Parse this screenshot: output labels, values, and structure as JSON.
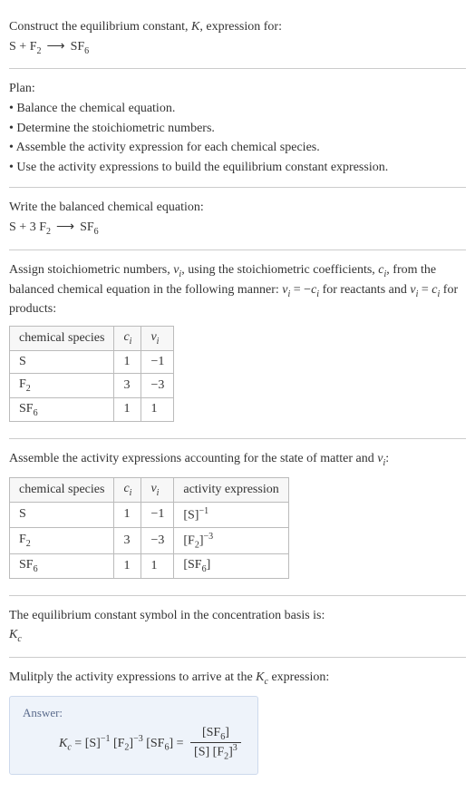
{
  "intro": {
    "line1": "Construct the equilibrium constant, ",
    "K": "K",
    "line1_cont": ", expression for:",
    "reactant1": "S",
    "plus": " + ",
    "reactant2_main": "F",
    "reactant2_sub": "2",
    "arrow": "⟶",
    "product_main": "SF",
    "product_sub": "6"
  },
  "plan": {
    "heading": "Plan:",
    "b1": "• Balance the chemical equation.",
    "b2": "• Determine the stoichiometric numbers.",
    "b3": "• Assemble the activity expression for each chemical species.",
    "b4": "• Use the activity expressions to build the equilibrium constant expression."
  },
  "balanced": {
    "title": "Write the balanced chemical equation:",
    "r1": "S",
    "plus": " + ",
    "coef2": "3 ",
    "r2_main": "F",
    "r2_sub": "2",
    "arrow": "⟶",
    "p_main": "SF",
    "p_sub": "6"
  },
  "stoich": {
    "text1": "Assign stoichiometric numbers, ",
    "nu": "ν",
    "nu_i": "i",
    "text2": ", using the stoichiometric coefficients, ",
    "c": "c",
    "c_i": "i",
    "text3": ", from the balanced chemical equation in the following manner: ",
    "eq1_lhs_nu": "ν",
    "eq1_lhs_i": "i",
    "eq1_eq": " = −",
    "eq1_rhs_c": "c",
    "eq1_rhs_i": "i",
    "text4": " for reactants and ",
    "eq2_lhs_nu": "ν",
    "eq2_lhs_i": "i",
    "eq2_eq": " = ",
    "eq2_rhs_c": "c",
    "eq2_rhs_i": "i",
    "text5": " for products:",
    "th_species": "chemical species",
    "th_c": "c",
    "th_c_i": "i",
    "th_nu": "ν",
    "th_nu_i": "i",
    "r1_species": "S",
    "r1_c": "1",
    "r1_nu": "−1",
    "r2_species_main": "F",
    "r2_species_sub": "2",
    "r2_c": "3",
    "r2_nu": "−3",
    "r3_species_main": "SF",
    "r3_species_sub": "6",
    "r3_c": "1",
    "r3_nu": "1"
  },
  "activity": {
    "title1": "Assemble the activity expressions accounting for the state of matter and ",
    "nu": "ν",
    "nu_i": "i",
    "title2": ":",
    "th_species": "chemical species",
    "th_c": "c",
    "th_c_i": "i",
    "th_nu": "ν",
    "th_nu_i": "i",
    "th_act": "activity expression",
    "r1_species": "S",
    "r1_c": "1",
    "r1_nu": "−1",
    "r1_act_body": "[S]",
    "r1_act_sup": "−1",
    "r2_species_main": "F",
    "r2_species_sub": "2",
    "r2_c": "3",
    "r2_nu": "−3",
    "r2_act_body_l": "[F",
    "r2_act_body_sub": "2",
    "r2_act_body_r": "]",
    "r2_act_sup": "−3",
    "r3_species_main": "SF",
    "r3_species_sub": "6",
    "r3_c": "1",
    "r3_nu": "1",
    "r3_act_body_l": "[SF",
    "r3_act_body_sub": "6",
    "r3_act_body_r": "]"
  },
  "kc_symbol": {
    "line1": "The equilibrium constant symbol in the concentration basis is:",
    "K": "K",
    "c": "c"
  },
  "multiply": {
    "line1": "Mulitply the activity expressions to arrive at the ",
    "K": "K",
    "c": "c",
    "line1_cont": " expression:"
  },
  "answer": {
    "label": "Answer:",
    "K": "K",
    "c": "c",
    "eq": " = ",
    "t1": "[S]",
    "t1_sup": "−1",
    "t2a": " [F",
    "t2_sub": "2",
    "t2b": "]",
    "t2_sup": "−3",
    "t3a": " [SF",
    "t3_sub": "6",
    "t3b": "]",
    "eq2": " = ",
    "num_a": "[SF",
    "num_sub": "6",
    "num_b": "]",
    "den_a": "[S] [F",
    "den_sub": "2",
    "den_b": "]",
    "den_sup": "3"
  }
}
